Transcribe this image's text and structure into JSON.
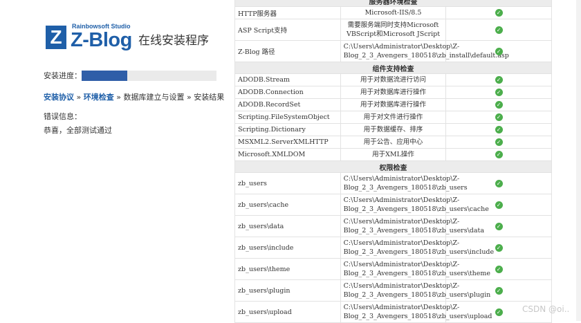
{
  "app": {
    "logo_letter": "Z",
    "logo_studio": "Rainbowsoft Studio",
    "logo_name": "Z-Blog",
    "logo_subtitle": "在线安装程序",
    "brand_color": "#1f5fa8"
  },
  "progress": {
    "label": "安装进度：",
    "fraction": 0.34
  },
  "steps": {
    "step1": "安装协议",
    "sep1": " » ",
    "step2": "环境检查",
    "sep2": " » ",
    "step3": "数据库建立与设置",
    "sep3": " » ",
    "step4": "安装结果"
  },
  "error": {
    "label": "错误信息：",
    "message": "恭喜，全部测试通过"
  },
  "table": {
    "sections": [
      {
        "title": "服务器环境检查",
        "rows": [
          {
            "name": "HTTP服务器",
            "desc": "Microsoft-IIS/8.5",
            "status": "ok"
          },
          {
            "name": "ASP Script支持",
            "desc": "需要服务端同时支持Microsoft VBScript和Microsoft JScript",
            "status": "ok"
          },
          {
            "name": "Z-Blog 路径",
            "desc": "C:\\Users\\Administrator\\Desktop\\Z-Blog_2_3_Avengers_180518\\zb_install\\default.asp",
            "status": "ok"
          }
        ]
      },
      {
        "title": "组件支持检查",
        "rows": [
          {
            "name": "ADODB.Stream",
            "desc": "用于对数据流进行访问",
            "status": "ok"
          },
          {
            "name": "ADODB.Connection",
            "desc": "用于对数据库进行操作",
            "status": "ok"
          },
          {
            "name": "ADODB.RecordSet",
            "desc": "用于对数据库进行操作",
            "status": "ok"
          },
          {
            "name": "Scripting.FileSystemObject",
            "desc": "用于对文件进行操作",
            "status": "ok"
          },
          {
            "name": "Scripting.Dictionary",
            "desc": "用于数据缓存、排序",
            "status": "ok"
          },
          {
            "name": "MSXML2.ServerXMLHTTP",
            "desc": "用于公告、应用中心",
            "status": "ok"
          },
          {
            "name": "Microsoft.XMLDOM",
            "desc": "用于XML操作",
            "status": "ok"
          }
        ]
      },
      {
        "title": "权限检查",
        "rows": [
          {
            "name": "zb_users",
            "desc": "C:\\Users\\Administrator\\Desktop\\Z-Blog_2_3_Avengers_180518\\zb_users",
            "status": "ok"
          },
          {
            "name": "zb_users\\cache",
            "desc": "C:\\Users\\Administrator\\Desktop\\Z-Blog_2_3_Avengers_180518\\zb_users\\cache",
            "status": "ok"
          },
          {
            "name": "zb_users\\data",
            "desc": "C:\\Users\\Administrator\\Desktop\\Z-Blog_2_3_Avengers_180518\\zb_users\\data",
            "status": "ok"
          },
          {
            "name": "zb_users\\include",
            "desc": "C:\\Users\\Administrator\\Desktop\\Z-Blog_2_3_Avengers_180518\\zb_users\\include",
            "status": "ok"
          },
          {
            "name": "zb_users\\theme",
            "desc": "C:\\Users\\Administrator\\Desktop\\Z-Blog_2_3_Avengers_180518\\zb_users\\theme",
            "status": "ok"
          },
          {
            "name": "zb_users\\plugin",
            "desc": "C:\\Users\\Administrator\\Desktop\\Z-Blog_2_3_Avengers_180518\\zb_users\\plugin",
            "status": "ok"
          },
          {
            "name": "zb_users\\upload",
            "desc": "C:\\Users\\Administrator\\Desktop\\Z-Blog_2_3_Avengers_180518\\zb_users\\upload",
            "status": "ok"
          }
        ]
      }
    ],
    "ok_color": "#4cae4c",
    "ok_icon": "check-circle-icon"
  },
  "watermark": "CSDN @oi.."
}
